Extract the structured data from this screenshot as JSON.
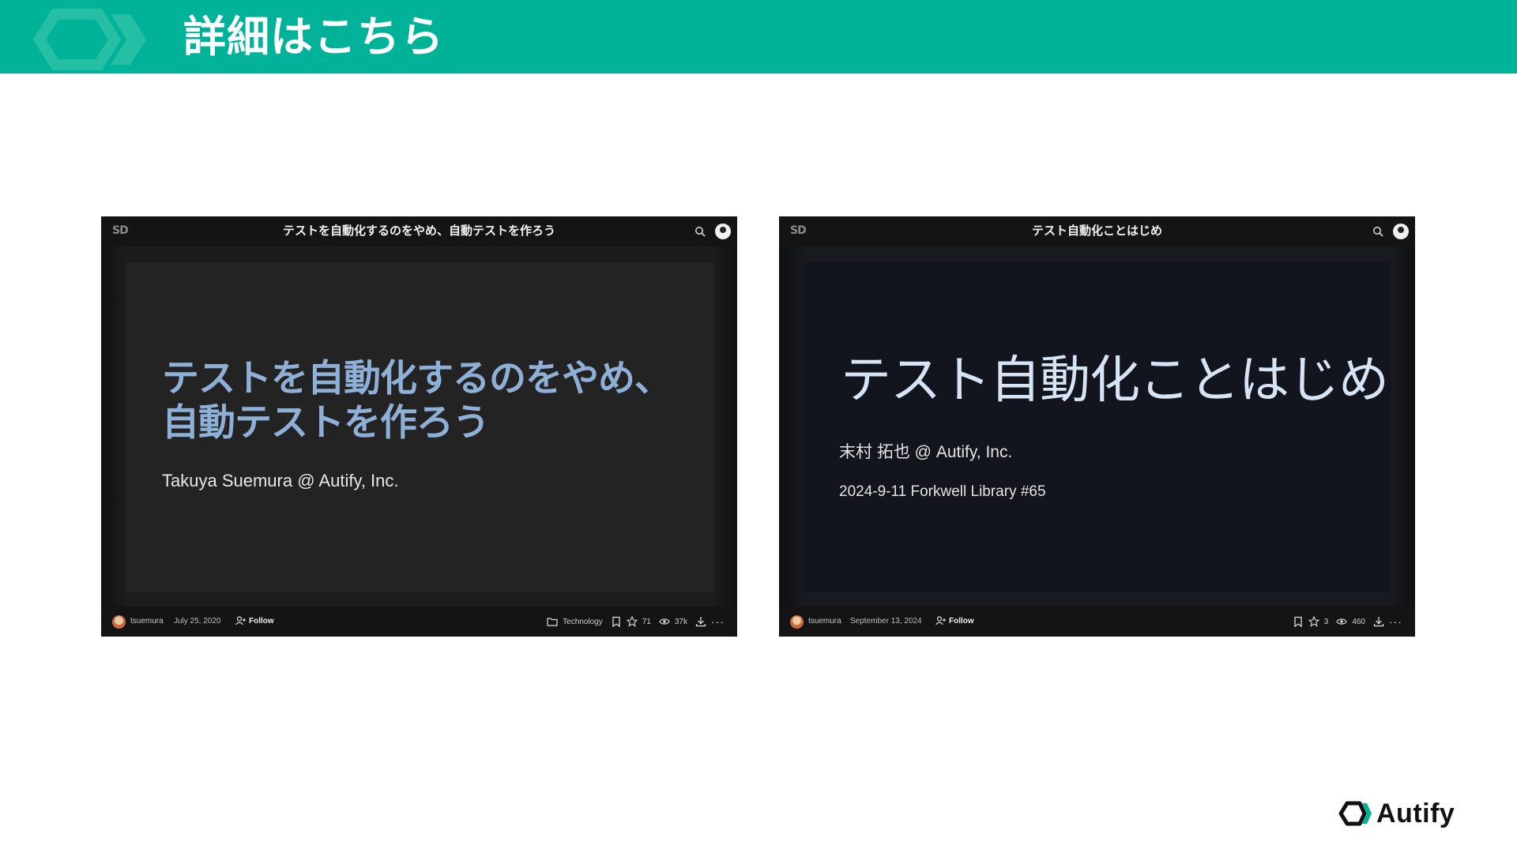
{
  "header": {
    "title": "詳細はこちら"
  },
  "colors": {
    "brand_green": "#00b398",
    "left_slide_title": "#8eb0d6",
    "right_slide_title": "#d6e4f5"
  },
  "cards": [
    {
      "site_logo": "SD",
      "deck_title": "テストを自動化するのをやめ、自動テストを作ろう",
      "slide": {
        "title_line1": "テストを自動化するのをやめ、",
        "title_line2": "自動テストを作ろう",
        "author": "Takuya Suemura @ Autify, Inc."
      },
      "footer": {
        "user": "tsuemura",
        "date": "July 25, 2020",
        "follow_label": "Follow",
        "category": "Technology",
        "stars": "71",
        "views": "37k"
      }
    },
    {
      "site_logo": "SD",
      "deck_title": "テスト自動化ことはじめ",
      "slide": {
        "title": "テスト自動化ことはじめ",
        "author": "末村 拓也 @ Autify, Inc.",
        "event": "2024-9-11 Forkwell Library #65"
      },
      "footer": {
        "user": "tsuemura",
        "date": "September 13, 2024",
        "follow_label": "Follow",
        "stars": "3",
        "views": "460"
      }
    }
  ],
  "brand": {
    "name": "Autify"
  },
  "icons": [
    "search-icon",
    "user-avatar-icon",
    "follow-icon",
    "folder-icon",
    "bookmark-icon",
    "star-icon",
    "eye-icon",
    "download-icon",
    "more-icon"
  ]
}
